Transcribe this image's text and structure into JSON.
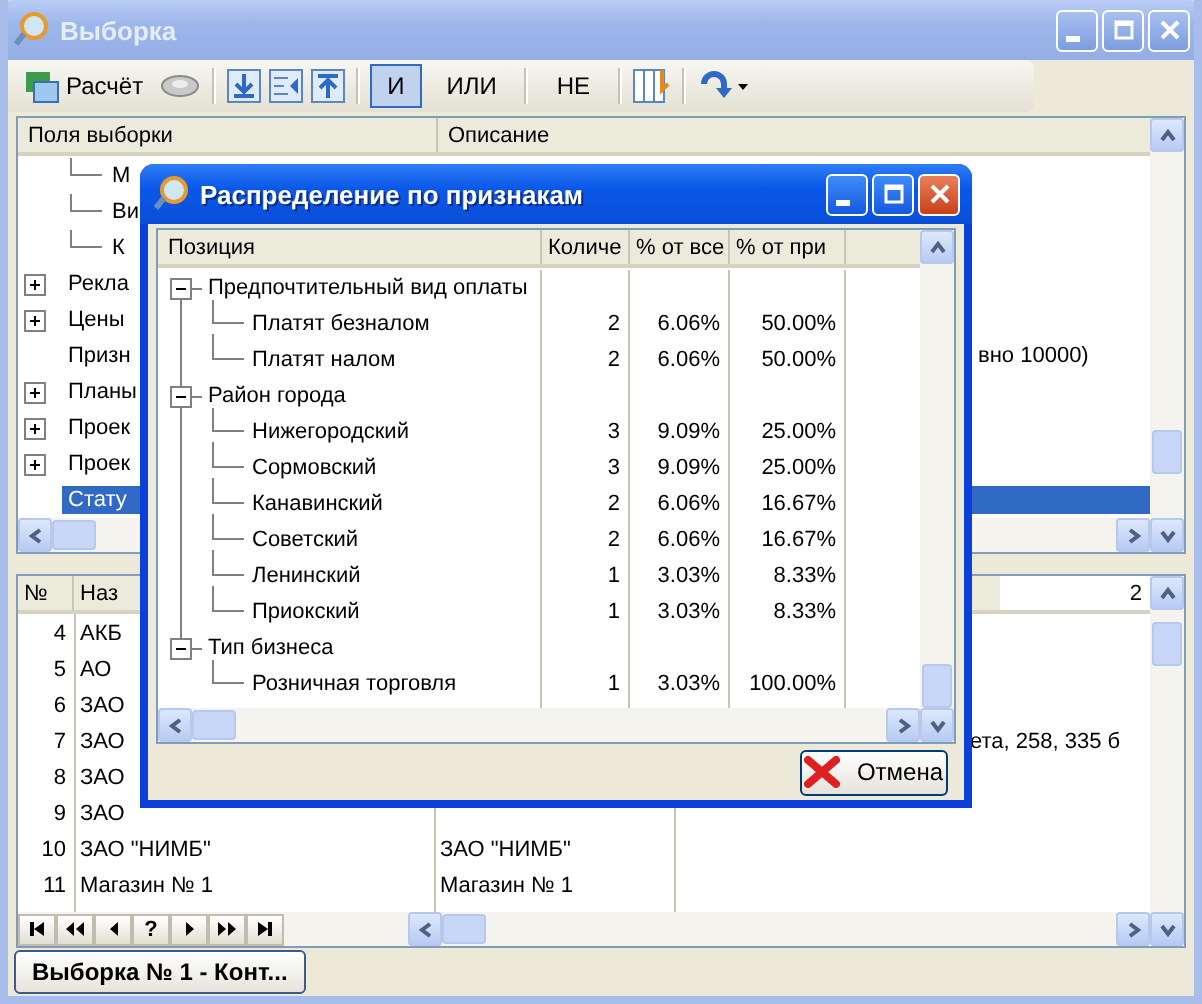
{
  "window": {
    "title": "Выборка"
  },
  "toolbar": {
    "calc_label": "Расчёт",
    "logic": [
      {
        "label": "И",
        "selected": true
      },
      {
        "label": "ИЛИ",
        "selected": false
      },
      {
        "label": "НЕ",
        "selected": false
      }
    ]
  },
  "fields": {
    "columns": [
      "Поля выборки",
      "Описание"
    ],
    "rows": [
      {
        "kind": "child",
        "label": "М",
        "selected": false
      },
      {
        "kind": "child",
        "label": "Ви",
        "selected": false
      },
      {
        "kind": "child",
        "label": "К",
        "selected": false
      },
      {
        "kind": "node",
        "label": "Рекла",
        "selected": false
      },
      {
        "kind": "node",
        "label": "Цены",
        "selected": false
      },
      {
        "kind": "leaf",
        "label": "Призн",
        "description": "вно 10000)",
        "selected": false
      },
      {
        "kind": "node",
        "label": "Планы",
        "selected": false
      },
      {
        "kind": "node",
        "label": "Проек",
        "selected": false
      },
      {
        "kind": "node",
        "label": "Проек",
        "selected": false
      },
      {
        "kind": "leaf",
        "label": "Стату",
        "selected": true
      }
    ]
  },
  "records": {
    "columns": [
      "№",
      "Наз"
    ],
    "extra_header": "2",
    "rows": [
      {
        "num": "4",
        "name": "АКБ"
      },
      {
        "num": "5",
        "name": "АО"
      },
      {
        "num": "6",
        "name": "ЗАО"
      },
      {
        "num": "7",
        "name": "ЗАО",
        "note": "ета, 258, 335 б"
      },
      {
        "num": "8",
        "name": "ЗАО"
      },
      {
        "num": "9",
        "name": "ЗАО"
      },
      {
        "num": "10",
        "name": "ЗАО \"НИМБ\"",
        "name_2": "ЗАО \"НИМБ\""
      },
      {
        "num": "11",
        "name": "Магазин № 1",
        "name_2": "Магазин № 1"
      }
    ],
    "help_label": "?"
  },
  "taskbar": {
    "button": "Выборка № 1 - Конт..."
  },
  "dialog": {
    "title": "Распределение по признакам",
    "columns": [
      "Позиция",
      "Количе",
      "% от все",
      "% от при"
    ],
    "groups": [
      {
        "label": "Предпочтительный вид оплаты",
        "expanded": true,
        "children": [
          {
            "label": "Платят безналом",
            "count": "2",
            "pct_all": "6.06%",
            "pct_group": "50.00%"
          },
          {
            "label": "Платят налом",
            "count": "2",
            "pct_all": "6.06%",
            "pct_group": "50.00%"
          }
        ]
      },
      {
        "label": "Район города",
        "expanded": true,
        "children": [
          {
            "label": "Нижегородский",
            "count": "3",
            "pct_all": "9.09%",
            "pct_group": "25.00%"
          },
          {
            "label": "Сормовский",
            "count": "3",
            "pct_all": "9.09%",
            "pct_group": "25.00%"
          },
          {
            "label": "Канавинский",
            "count": "2",
            "pct_all": "6.06%",
            "pct_group": "16.67%"
          },
          {
            "label": "Советский",
            "count": "2",
            "pct_all": "6.06%",
            "pct_group": "16.67%"
          },
          {
            "label": "Ленинский",
            "count": "1",
            "pct_all": "3.03%",
            "pct_group": "8.33%"
          },
          {
            "label": "Приокский",
            "count": "1",
            "pct_all": "3.03%",
            "pct_group": "8.33%"
          }
        ]
      },
      {
        "label": "Тип бизнеса",
        "expanded": true,
        "children": [
          {
            "label": "Розничная торговля",
            "count": "1",
            "pct_all": "3.03%",
            "pct_group": "100.00%"
          }
        ]
      }
    ],
    "cancel_button": "Отмена"
  }
}
